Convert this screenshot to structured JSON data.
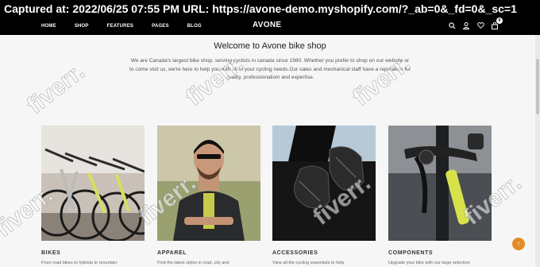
{
  "capture": {
    "text": "Captured at: 2022/06/25 07:55 PM    URL: https://avone-demo.myshopify.com/?_ab=0&_fd=0&_sc=1"
  },
  "nav": {
    "links": [
      "HOME",
      "SHOP",
      "FEATURES",
      "PAGES",
      "BLOG"
    ],
    "logo": "AVONE",
    "cart_count": "0",
    "icons": [
      "search-icon",
      "account-icon",
      "wishlist-icon",
      "cart-icon"
    ]
  },
  "intro": {
    "title": "Welcome to Avone bike shop",
    "text": "We are Canada's largest bike shop, serving cyclists in canada since 1980. Whether you prefer to shop on our website or to come visit us, we're here to help you with all of your cycling needs.Our sales and mechanical staff have a reputation for quality, professionalism and expertise."
  },
  "categories": [
    {
      "title": "BIKES",
      "desc": "From road bikes to hybrids to mountain"
    },
    {
      "title": "APPAREL",
      "desc": "Find the latest styles in road, city and"
    },
    {
      "title": "ACCESSORIES",
      "desc": "View all the cycling essentials to help"
    },
    {
      "title": "COMPONENTS",
      "desc": "Upgrade your bike with our large selection"
    }
  ],
  "watermark": "fiverr."
}
